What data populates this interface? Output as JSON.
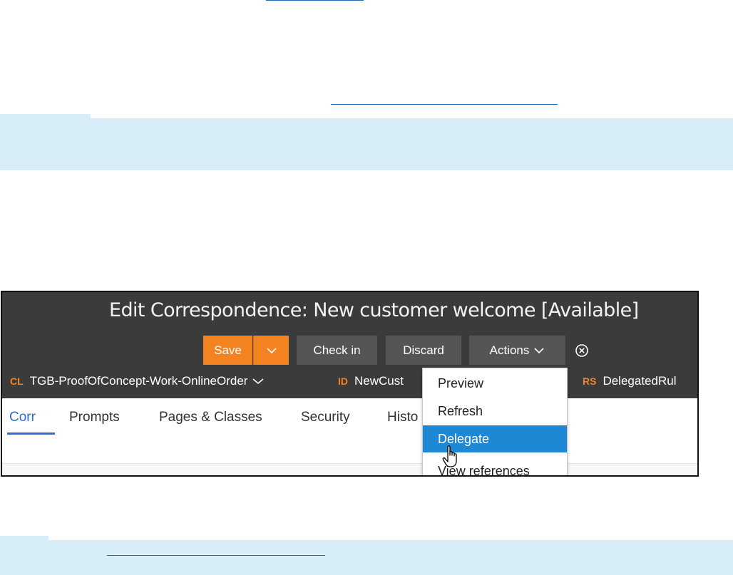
{
  "window": {
    "title": "Edit Correspondence: New customer welcome [Available]"
  },
  "toolbar": {
    "save_label": "Save",
    "check_in_label": "Check in",
    "discard_label": "Discard",
    "actions_label": "Actions"
  },
  "meta": {
    "cl_key": "CL",
    "cl_value": "TGB-ProofOfConcept-Work-OnlineOrder",
    "id_key": "ID",
    "id_value": "NewCust",
    "rs_key": "RS",
    "rs_value": "DelegatedRul"
  },
  "tabs": [
    {
      "label": "Corr",
      "active": true
    },
    {
      "label": "Prompts"
    },
    {
      "label": "Pages & Classes"
    },
    {
      "label": "Security"
    },
    {
      "label": "Histo"
    }
  ],
  "actions_menu": {
    "items": [
      {
        "label": "Preview"
      },
      {
        "label": "Refresh"
      },
      {
        "label": "Delegate",
        "highlighted": true
      },
      {
        "label": "View references"
      }
    ]
  },
  "icons": {
    "save_dropdown": "chevron-down-icon",
    "actions_dropdown": "chevron-down-icon",
    "close": "close-circle-icon",
    "cl_dropdown": "chevron-down-icon",
    "pointer": "hand-cursor-icon"
  },
  "colors": {
    "accent": "#f58220",
    "header_bg": "#3b3b3b",
    "button_grey": "#555555",
    "tab_active": "#2f6dd0",
    "menu_highlight": "#1f88d4",
    "note_band": "#d7eef9"
  }
}
